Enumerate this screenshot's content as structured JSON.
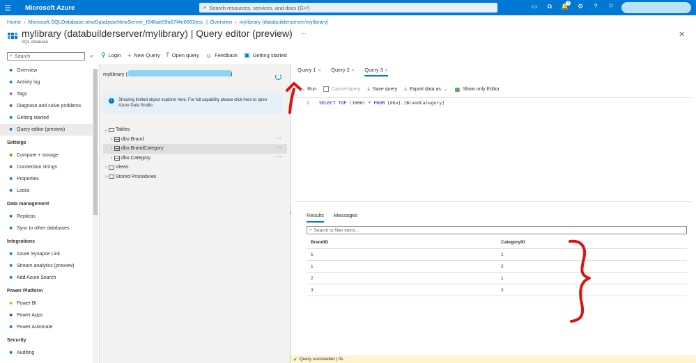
{
  "topbar": {
    "brand": "Microsoft Azure",
    "search_placeholder": "Search resources, services, and docs (G+/)",
    "notification_count": "1"
  },
  "breadcrumb": [
    "Home",
    "Microsoft.SQLDatabase.newDatabaseNewServer_f248ae09a67f4e6682ecc",
    "Overview",
    "mylibrary (databuilderserver/mylibrary)"
  ],
  "header": {
    "title": "mylibrary (databuilderserver/mylibrary) | Query editor (preview)",
    "subtitle": "SQL database"
  },
  "sidebar": {
    "search_placeholder": "Search",
    "items": [
      {
        "label": "Overview",
        "icon": "sql-icon",
        "color": "#0078d4"
      },
      {
        "label": "Activity log",
        "icon": "log-icon",
        "color": "#0078d4"
      },
      {
        "label": "Tags",
        "icon": "tag-icon",
        "color": "#8661c5"
      },
      {
        "label": "Diagnose and solve problems",
        "icon": "wrench-icon",
        "color": "#605e5c"
      },
      {
        "label": "Getting started",
        "icon": "cloud-icon",
        "color": "#0078d4"
      },
      {
        "label": "Query editor (preview)",
        "icon": "query-icon",
        "color": "#0078d4",
        "active": true
      }
    ],
    "sections": [
      {
        "heading": "Settings",
        "items": [
          {
            "label": "Compute + storage",
            "icon": "compute-icon",
            "color": "#57a300"
          },
          {
            "label": "Connection strings",
            "icon": "link-icon",
            "color": "#605e5c"
          },
          {
            "label": "Properties",
            "icon": "properties-icon",
            "color": "#0078d4"
          },
          {
            "label": "Locks",
            "icon": "lock-icon",
            "color": "#0078d4"
          }
        ]
      },
      {
        "heading": "Data management",
        "items": [
          {
            "label": "Replicas",
            "icon": "globe-icon",
            "color": "#0078d4"
          },
          {
            "label": "Sync to other databases",
            "icon": "sync-icon",
            "color": "#0078d4"
          }
        ]
      },
      {
        "heading": "Integrations",
        "items": [
          {
            "label": "Azure Synapse Link",
            "icon": "synapse-icon",
            "color": "#0078d4"
          },
          {
            "label": "Stream analytics (preview)",
            "icon": "stream-icon",
            "color": "#0078d4"
          },
          {
            "label": "Add Azure Search",
            "icon": "cloud-search-icon",
            "color": "#0078d4"
          }
        ]
      },
      {
        "heading": "Power Platform",
        "items": [
          {
            "label": "Power BI",
            "icon": "powerbi-icon",
            "color": "#e8b100"
          },
          {
            "label": "Power Apps",
            "icon": "powerapps-icon",
            "color": "#742774"
          },
          {
            "label": "Power Automate",
            "icon": "powerautomate-icon",
            "color": "#0066ff"
          }
        ]
      },
      {
        "heading": "Security",
        "items": [
          {
            "label": "Auditing",
            "icon": "audit-icon",
            "color": "#0078d4"
          }
        ]
      }
    ]
  },
  "toolbar": {
    "login": "Login",
    "new_query": "New Query",
    "open_query": "Open query",
    "feedback": "Feedback",
    "getting_started": "Getting started"
  },
  "explorer": {
    "db_label": "mylibrary (",
    "db_suffix": ")",
    "info": "Showing limited object explorer here. For full capability please click here to open Azure Data Studio.",
    "tree": [
      {
        "label": "Tables",
        "level": 0,
        "expanded": true,
        "kind": "folder"
      },
      {
        "label": "dbo.Brand",
        "level": 1,
        "kind": "table",
        "menu": "···"
      },
      {
        "label": "dbo.BrandCategory",
        "level": 1,
        "kind": "table",
        "menu": "···",
        "selected": true
      },
      {
        "label": "dbo.Category",
        "level": 1,
        "kind": "table",
        "menu": "···"
      },
      {
        "label": "Views",
        "level": 0,
        "kind": "folder"
      },
      {
        "label": "Stored Procedures",
        "level": 0,
        "kind": "folder"
      }
    ]
  },
  "query": {
    "tabs": [
      {
        "label": "Query 1"
      },
      {
        "label": "Query 2"
      },
      {
        "label": "Query 3",
        "active": true
      }
    ],
    "run": "Run",
    "cancel": "Cancel query",
    "save": "Save query",
    "export": "Export data as",
    "show_only_editor": "Show only Editor",
    "line_number": "1",
    "sql_kw1": "SELECT TOP",
    "sql_rest": " (1000) * ",
    "sql_kw2": "FROM",
    "sql_table": " [dbo].[BrandCategory]"
  },
  "results": {
    "tabs": [
      "Results",
      "Messages"
    ],
    "filter_placeholder": "Search to filter items...",
    "columns": [
      "BrandID",
      "CategoryID"
    ],
    "rows": [
      [
        "1",
        "1"
      ],
      [
        "1",
        "2"
      ],
      [
        "2",
        "1"
      ],
      [
        "3",
        "3"
      ]
    ]
  },
  "status": {
    "text": "Query succeeded | 0s"
  },
  "colors": {
    "accent": "#0078d4",
    "annotation": "#e0120f"
  }
}
